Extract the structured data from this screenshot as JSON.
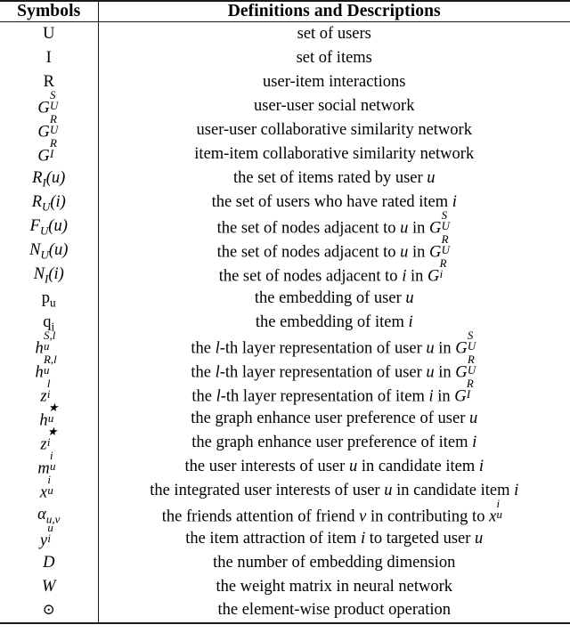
{
  "table": {
    "headers": {
      "symbol_column": "Symbols",
      "definition_column": "Definitions and Descriptions"
    },
    "rows": [
      {
        "symbol": "U",
        "definition": "set of users"
      },
      {
        "symbol": "I",
        "definition": "set of items"
      },
      {
        "symbol": "R",
        "definition": "user-item interactions"
      },
      {
        "symbol": "G_U^S",
        "definition": "user-user social network"
      },
      {
        "symbol": "G_U^R",
        "definition": "user-user collaborative similarity network"
      },
      {
        "symbol": "G_I^R",
        "definition": "item-item collaborative similarity network"
      },
      {
        "symbol": "R_I(u)",
        "definition": "the set of items rated by user u"
      },
      {
        "symbol": "R_U(i)",
        "definition": "the set of users who have rated item i"
      },
      {
        "symbol": "F_U(u)",
        "definition": "the set of nodes adjacent to u in G_U^S"
      },
      {
        "symbol": "N_U(u)",
        "definition": "the set of nodes adjacent to u in G_U^R"
      },
      {
        "symbol": "N_I(i)",
        "definition": "the set of nodes adjacent to i in G_i^R"
      },
      {
        "symbol": "p_u",
        "definition": "the embedding of user u"
      },
      {
        "symbol": "q_i",
        "definition": "the embedding of item i"
      },
      {
        "symbol": "h_u^{S,l}",
        "definition": "the l-th layer representation of user u in G_U^S"
      },
      {
        "symbol": "h_u^{R,l}",
        "definition": "the l-th layer representation of user u in G_U^R"
      },
      {
        "symbol": "z_i^l",
        "definition": "the l-th layer representation of item i in G_I^R"
      },
      {
        "symbol": "h_u^star",
        "definition": "the graph enhance user preference of user u"
      },
      {
        "symbol": "z_i^star",
        "definition": "the graph enhance user preference of item i"
      },
      {
        "symbol": "m_u^i",
        "definition": "the user interests of user u in candidate item i"
      },
      {
        "symbol": "x_u^i",
        "definition": "the integrated user interests of user u in candidate item i"
      },
      {
        "symbol": "alpha_{u,v}",
        "definition": "the friends attention of friend v in contributing to x_u^i"
      },
      {
        "symbol": "y_i^u",
        "definition": "the item attraction of item i to targeted user u"
      },
      {
        "symbol": "D",
        "definition": "the number of embedding dimension"
      },
      {
        "symbol": "W",
        "definition": "the weight matrix in neural network"
      },
      {
        "symbol": "odot",
        "definition": "the element-wise product operation"
      }
    ]
  },
  "style": {
    "rule_color": "#1a1a1a",
    "text_color": "#000000",
    "background": "#ffffff"
  }
}
